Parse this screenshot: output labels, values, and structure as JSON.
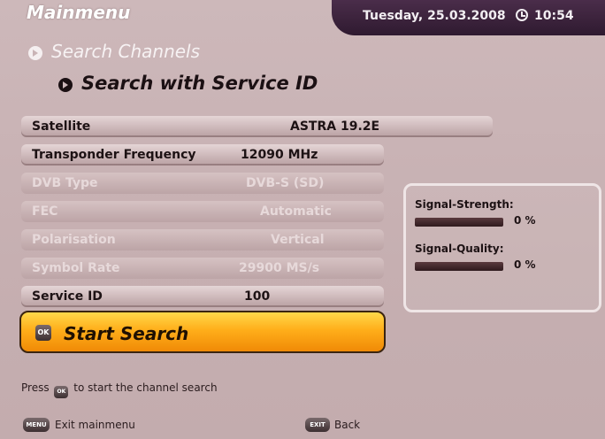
{
  "header": {
    "title": "Mainmenu",
    "date": "Tuesday, 25.03.2008",
    "time": "10:54"
  },
  "breadcrumb": {
    "level1": "Search Channels",
    "level2": "Search with Service ID"
  },
  "settings": [
    {
      "label": "Satellite",
      "value": "ASTRA 19.2E",
      "enabled": true
    },
    {
      "label": "Transponder Frequency",
      "value": "12090 MHz",
      "enabled": true
    },
    {
      "label": "DVB Type",
      "value": "DVB-S (SD)",
      "enabled": false
    },
    {
      "label": "FEC",
      "value": "Automatic",
      "enabled": false
    },
    {
      "label": "Polarisation",
      "value": "Vertical",
      "enabled": false
    },
    {
      "label": "Symbol Rate",
      "value": "29900 MS/s",
      "enabled": false
    },
    {
      "label": "Service ID",
      "value": "100",
      "enabled": true
    }
  ],
  "start_button": {
    "label": "Start Search",
    "key": "OK"
  },
  "signal": {
    "strength_label": "Signal-Strength:",
    "strength_value": "0 %",
    "strength_fraction": 0,
    "quality_label": "Signal-Quality:",
    "quality_value": "0 %",
    "quality_fraction": 0
  },
  "hint": {
    "prefix": "Press",
    "key": "OK",
    "suffix": "to start the channel search"
  },
  "footer": {
    "menu_key": "MENU",
    "menu_label": "Exit mainmenu",
    "exit_key": "EXIT",
    "exit_label": "Back"
  }
}
